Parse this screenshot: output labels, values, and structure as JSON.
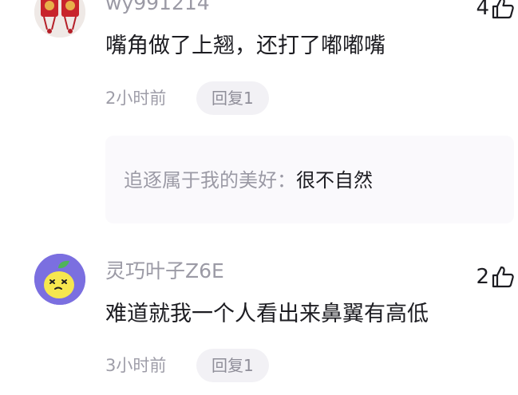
{
  "comments": [
    {
      "username": "wy991214",
      "text": "嘴角做了上翘，还打了嘟嘟嘴",
      "time": "2小时前",
      "reply_label": "回复1",
      "likes": "4",
      "replies": [
        {
          "author": "追逐属于我的美好",
          "separator": "：",
          "text": "很不自然"
        }
      ]
    },
    {
      "username": "灵巧叶子Z6E",
      "text": "难道就我一个人看出来鼻翼有高低",
      "time": "3小时前",
      "reply_label": "回复1",
      "likes": "2"
    }
  ],
  "icons": {
    "like": "thumbs-up-icon",
    "avatar_1": "red-envelope-avatar",
    "avatar_2": "yellow-lemon-avatar"
  },
  "colors": {
    "text_primary": "#1d1d22",
    "text_secondary": "#9b9aa5",
    "pill_bg": "#f2f1f5",
    "reply_box_bg": "#faf9fc",
    "avatar_2_bg": "#7b6fe0"
  }
}
